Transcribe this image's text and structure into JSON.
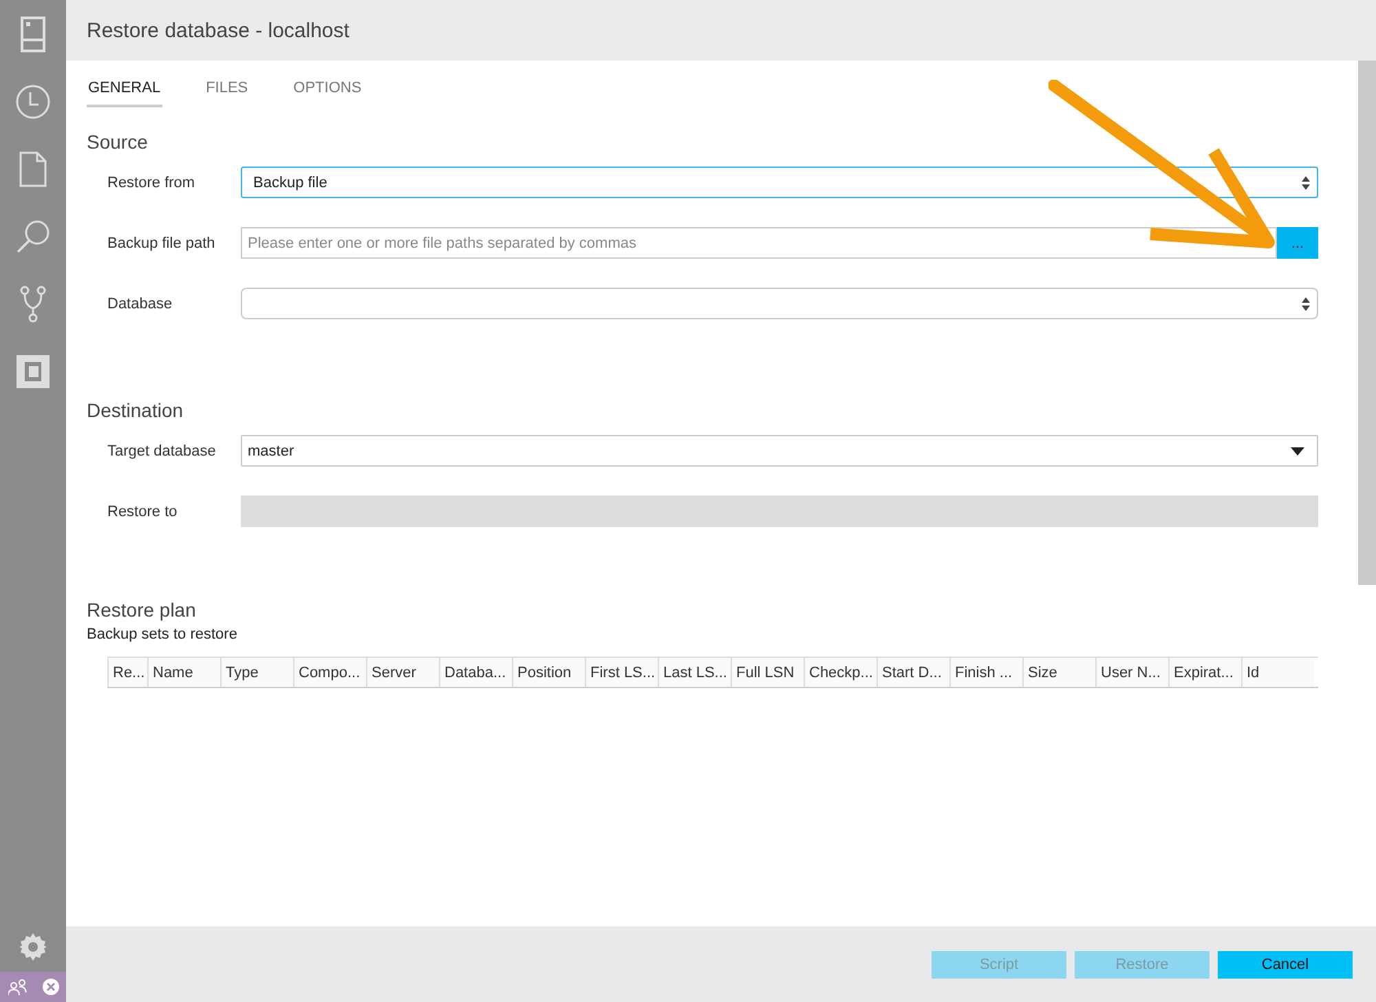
{
  "window": {
    "title": "Restore database - localhost"
  },
  "tabs": [
    {
      "label": "GENERAL",
      "selected": true
    },
    {
      "label": "FILES",
      "selected": false
    },
    {
      "label": "OPTIONS",
      "selected": false
    }
  ],
  "source": {
    "heading": "Source",
    "fields": [
      {
        "kind": "select",
        "label": "Restore from",
        "value": "Backup file",
        "focused": true
      },
      {
        "kind": "path",
        "label": "Backup file path",
        "placeholder": "Please enter one or more file paths separated by commas",
        "button": "..."
      },
      {
        "kind": "select",
        "label": "Database",
        "focused": false
      }
    ]
  },
  "destination": {
    "heading": "Destination",
    "fields": [
      {
        "kind": "dropdown",
        "label": "Target database",
        "value": "master"
      },
      {
        "kind": "readonly",
        "label": "Restore to"
      }
    ]
  },
  "restore_plan": {
    "heading": "Restore plan",
    "subheading": "Backup sets to restore",
    "columns": [
      "Re...",
      "Name",
      "Type",
      "Compo...",
      "Server",
      "Databa...",
      "Position",
      "First LS...",
      "Last LS...",
      "Full LSN",
      "Checkp...",
      "Start D...",
      "Finish ...",
      "Size",
      "User N...",
      "Expirat...",
      "Id"
    ]
  },
  "buttons": [
    {
      "label": "Script",
      "disabled": true
    },
    {
      "label": "Restore",
      "disabled": true
    },
    {
      "label": "Cancel",
      "disabled": false
    }
  ]
}
